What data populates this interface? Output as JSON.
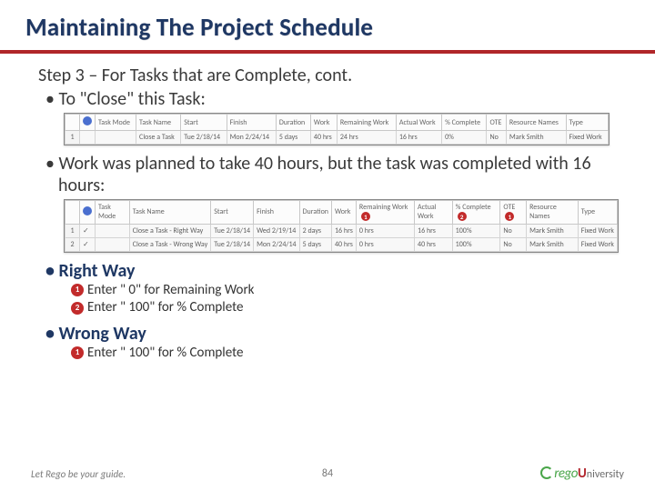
{
  "title": "Maintaining The Project Schedule",
  "step_heading": "Step 3 – For Tasks that are Complete, cont.",
  "bullets": {
    "close_task": "To \"Close\" this Task:",
    "work_planned": "Work was planned to take 40 hours, but the task was completed with 16 hours:",
    "right_way": "Right Way",
    "wrong_way": "Wrong Way"
  },
  "right_way_items": [
    {
      "n": "1",
      "text": "Enter \" 0\" for Remaining Work"
    },
    {
      "n": "2",
      "text": "Enter \" 100\" for % Complete"
    }
  ],
  "wrong_way_items": [
    {
      "n": "1",
      "text": "Enter \" 100\" for % Complete"
    }
  ],
  "table1": {
    "headers": [
      "",
      "",
      "Task Mode",
      "Task Name",
      "Start",
      "Finish",
      "Duration",
      "Work",
      "Remaining Work",
      "Actual Work",
      "% Complete",
      "OTE",
      "Resource Names",
      "Type"
    ],
    "rows": [
      [
        "1",
        "",
        "",
        "Close a Task",
        "Tue 2/18/14",
        "Mon 2/24/14",
        "5 days",
        "40 hrs",
        "24 hrs",
        "16 hrs",
        "0%",
        "No",
        "Mark Smith",
        "Fixed Work"
      ]
    ]
  },
  "table2": {
    "headers": [
      "",
      "",
      "Task Mode",
      "Task Name",
      "Start",
      "Finish",
      "Duration",
      "Work",
      "Remaining Work",
      "Actual Work",
      "% Complete",
      "OTE",
      "Resource Names",
      "Type"
    ],
    "rows": [
      [
        "1",
        "✓",
        "",
        "Close a Task - Right Way",
        "Tue 2/18/14",
        "Wed 2/19/14",
        "2 days",
        "16 hrs",
        "0 hrs",
        "16 hrs",
        "100%",
        "No",
        "Mark Smith",
        "Fixed Work"
      ],
      [
        "2",
        "✓",
        "",
        "Close a Task - Wrong Way",
        "Tue 2/18/14",
        "Mon 2/24/14",
        "5 days",
        "40 hrs",
        "0 hrs",
        "40 hrs",
        "100%",
        "No",
        "Mark Smith",
        "Fixed Work"
      ]
    ],
    "badges": {
      "remaining_col": "1",
      "complete_col": "2",
      "ote_col": "1"
    }
  },
  "footer": {
    "left": "Let Rego be your guide.",
    "page": "84",
    "logo_rego": "rego",
    "logo_u": "U",
    "logo_rest": "niversity"
  }
}
